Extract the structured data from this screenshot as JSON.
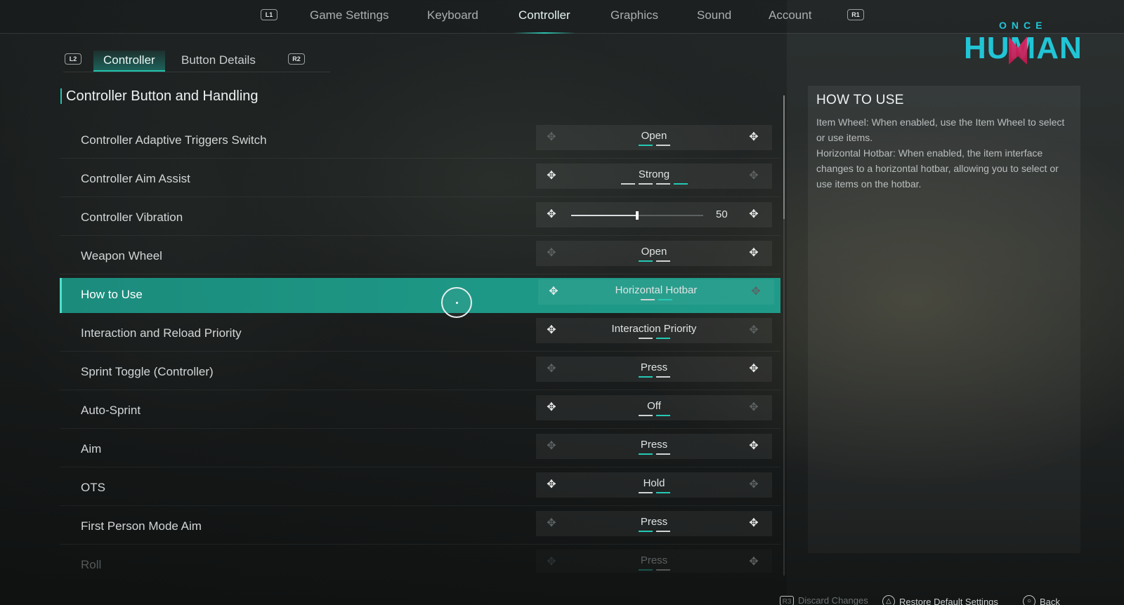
{
  "topnav": {
    "left_bumper": "L1",
    "right_bumper": "R1",
    "tabs": [
      {
        "label": "Game Settings"
      },
      {
        "label": "Keyboard"
      },
      {
        "label": "Controller",
        "active": true
      },
      {
        "label": "Graphics"
      },
      {
        "label": "Sound"
      },
      {
        "label": "Account"
      }
    ]
  },
  "logo": {
    "top": "ONCE",
    "bottom": "HUMAN",
    "brand_color": "#21c5d6",
    "accent_color": "#e5276a"
  },
  "subtabs": {
    "left_bumper": "L2",
    "right_bumper": "R2",
    "tabs": [
      {
        "label": "Controller",
        "active": true
      },
      {
        "label": "Button Details"
      }
    ]
  },
  "section_title": "Controller Button and Handling",
  "settings": [
    {
      "label": "Controller Adaptive Triggers Switch",
      "type": "select",
      "value": "Open",
      "options_count": 2,
      "selected_index": 0
    },
    {
      "label": "Controller Aim Assist",
      "type": "select",
      "value": "Strong",
      "options_count": 4,
      "selected_index": 3
    },
    {
      "label": "Controller Vibration",
      "type": "slider",
      "value": "50",
      "fraction": 0.5
    },
    {
      "label": "Weapon Wheel",
      "type": "select",
      "value": "Open",
      "options_count": 2,
      "selected_index": 0
    },
    {
      "label": "How to Use",
      "type": "select",
      "value": "Horizontal Hotbar",
      "options_count": 2,
      "selected_index": 1,
      "selected": true
    },
    {
      "label": "Interaction and Reload Priority",
      "type": "select",
      "value": "Interaction Priority",
      "options_count": 2,
      "selected_index": 1
    },
    {
      "label": "Sprint Toggle (Controller)",
      "type": "select",
      "value": "Press",
      "options_count": 2,
      "selected_index": 0
    },
    {
      "label": "Auto-Sprint",
      "type": "select",
      "value": "Off",
      "options_count": 2,
      "selected_index": 1
    },
    {
      "label": "Aim",
      "type": "select",
      "value": "Press",
      "options_count": 2,
      "selected_index": 0
    },
    {
      "label": "OTS",
      "type": "select",
      "value": "Hold",
      "options_count": 2,
      "selected_index": 1
    },
    {
      "label": "First Person Mode Aim",
      "type": "select",
      "value": "Press",
      "options_count": 2,
      "selected_index": 0
    },
    {
      "label": "Roll",
      "type": "select",
      "value": "Press",
      "options_count": 2,
      "selected_index": 0,
      "faded": true
    }
  ],
  "info_panel": {
    "title": "HOW TO USE",
    "body": "Item Wheel: When enabled, use the Item Wheel to select or use items.\nHorizontal Hotbar: When enabled, the item interface changes to a horizontal hotbar, allowing you to select or use items on the hotbar."
  },
  "footer": {
    "discard_icon": "R3",
    "discard": "Discard Changes",
    "restore_icon": "△",
    "restore": "Restore Default Settings",
    "back_icon": "○",
    "back": "Back"
  },
  "colors": {
    "accent": "#22c2ad",
    "selected_row": "#1e9886"
  },
  "icons": {
    "dpad": "dpad-icon"
  }
}
